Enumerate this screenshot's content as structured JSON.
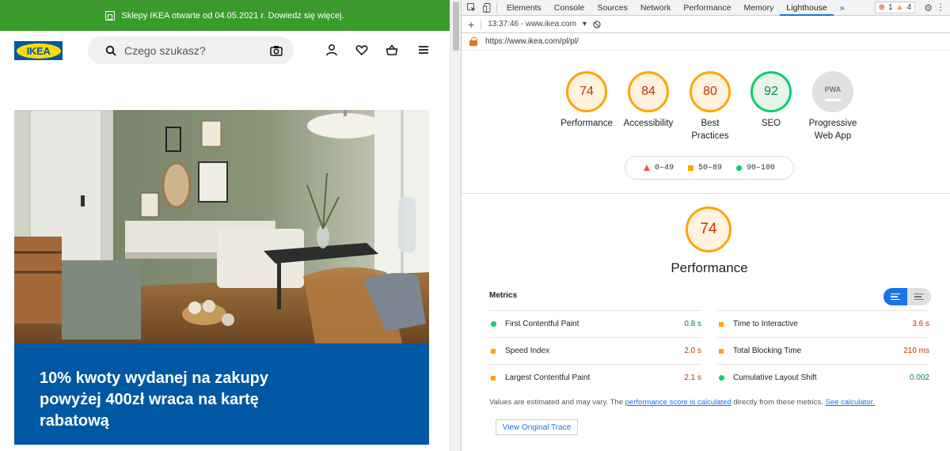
{
  "site": {
    "banner_text": "Sklepy IKEA otwarte od 04.05.2021 r. Dowiedz się więcej.",
    "logo_text": "IKEA",
    "search_placeholder": "Czego szukasz?",
    "promo_text": "10% kwoty wydanej na zakupy powyżej 400zł wraca na kartę rabatową",
    "colors": {
      "banner": "#3a9a2c",
      "brand_blue": "#0058a3",
      "brand_yellow": "#ffdb00"
    }
  },
  "devtools": {
    "tabs": [
      "Elements",
      "Console",
      "Sources",
      "Network",
      "Performance",
      "Memory",
      "Lighthouse"
    ],
    "active_tab": "Lighthouse",
    "more_tabs": "»",
    "errors": "1",
    "warnings": "4",
    "report_selector": "13:37:46 - www.ikea.com",
    "url": "https://www.ikea.com/pl/pl/",
    "gauges": [
      {
        "label": "Performance",
        "score": "74",
        "rating": "avg"
      },
      {
        "label": "Accessibility",
        "score": "84",
        "rating": "avg"
      },
      {
        "label": "Best Practices",
        "score": "80",
        "rating": "avg"
      },
      {
        "label": "SEO",
        "score": "92",
        "rating": "pass"
      },
      {
        "label": "Progressive Web App",
        "score": "PWA",
        "rating": "na"
      }
    ],
    "legend": {
      "fail": "0–49",
      "average": "50–89",
      "pass": "90–100"
    },
    "performance": {
      "score": "74",
      "title": "Performance"
    },
    "metrics_heading": "Metrics",
    "metrics_left": [
      {
        "name": "First Contentful Paint",
        "value": "0.8 s",
        "rating": "pass"
      },
      {
        "name": "Speed Index",
        "value": "2.0 s",
        "rating": "avg"
      },
      {
        "name": "Largest Contentful Paint",
        "value": "2.1 s",
        "rating": "avg"
      }
    ],
    "metrics_right": [
      {
        "name": "Time to Interactive",
        "value": "3.6 s",
        "rating": "avg"
      },
      {
        "name": "Total Blocking Time",
        "value": "210 ms",
        "rating": "avg"
      },
      {
        "name": "Cumulative Layout Shift",
        "value": "0.002",
        "rating": "pass"
      }
    ],
    "note": {
      "pre": "Values are estimated and may vary. The ",
      "link1": "performance score is calculated",
      "mid": " directly from these metrics. ",
      "link2": "See calculator."
    },
    "trace_button": "View Original Trace"
  }
}
